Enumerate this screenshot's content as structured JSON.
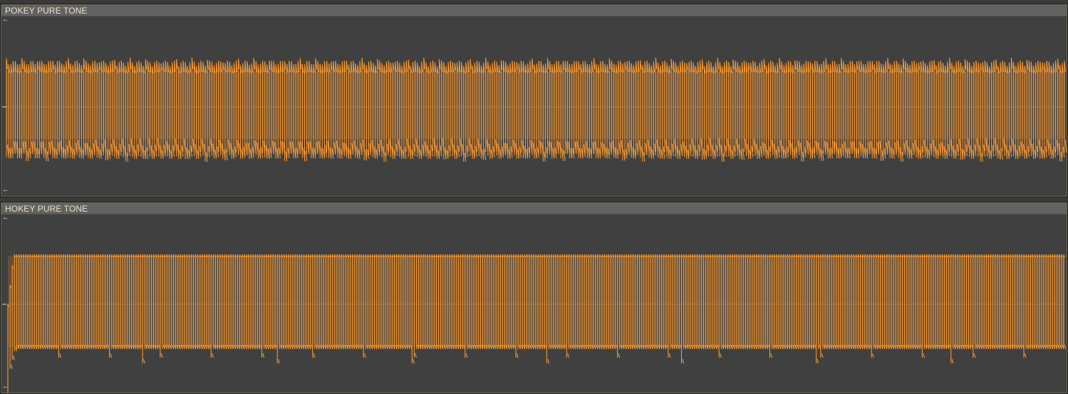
{
  "tracks": [
    {
      "title": "POKEY PURE TONE",
      "wave_color": "#ff9c32",
      "wave_style": "modulated-square"
    },
    {
      "title": "HOKEY PURE TONE",
      "wave_color": "#ff9c32",
      "wave_style": "clean-square"
    }
  ],
  "colors": {
    "background": "#404040",
    "header": "#626262",
    "header_text": "#f0e0c8",
    "zero_line": "#c8a070"
  },
  "icons": {
    "scroll_arrow": "left-arrow-icon"
  }
}
